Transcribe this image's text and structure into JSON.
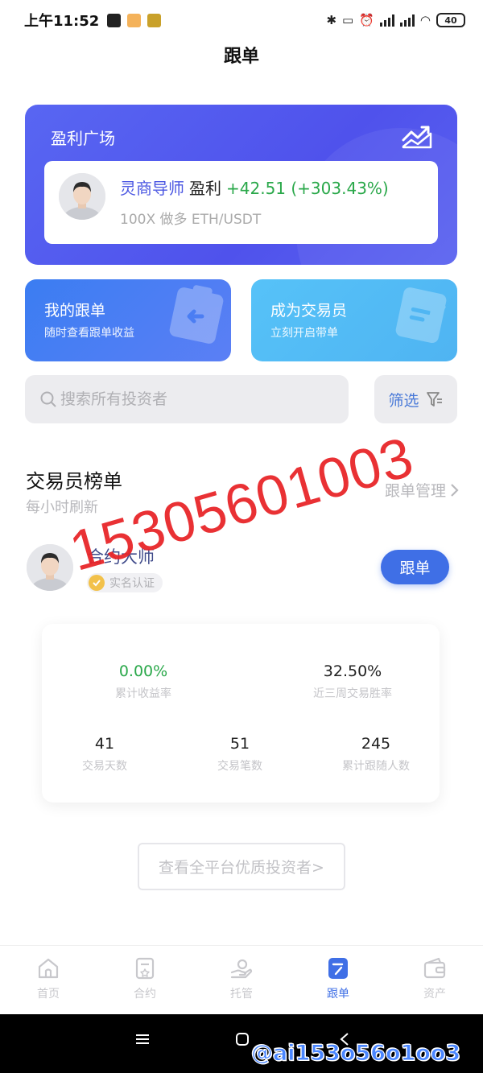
{
  "status_bar": {
    "time": "上午11:52",
    "battery": "40"
  },
  "header": {
    "title": "跟单"
  },
  "profit_square": {
    "title": "盈利广场",
    "trader_name": "灵商导师",
    "profit_label": "盈利",
    "profit_value": "+42.51 (+303.43%)",
    "position_desc": "100X 做多 ETH/USDT"
  },
  "quick_actions": [
    {
      "title": "我的跟单",
      "subtitle": "随时查看跟单收益"
    },
    {
      "title": "成为交易员",
      "subtitle": "立刻开启带单"
    }
  ],
  "search": {
    "placeholder": "搜索所有投资者",
    "filter_label": "筛选"
  },
  "leaderboard": {
    "title": "交易员榜单",
    "subtitle": "每小时刷新",
    "manage_link": "跟单管理"
  },
  "trader": {
    "name": "合约大师",
    "verified_label": "实名认证",
    "follow_label": "跟单",
    "stats": {
      "cumulative_return": {
        "value": "0.00%",
        "label": "累计收益率"
      },
      "win_rate_3w": {
        "value": "32.50%",
        "label": "近三周交易胜率"
      },
      "trading_days": {
        "value": "41",
        "label": "交易天数"
      },
      "trade_count": {
        "value": "51",
        "label": "交易笔数"
      },
      "followers": {
        "value": "245",
        "label": "累计跟随人数"
      }
    }
  },
  "view_all_label": "查看全平台优质投资者>",
  "watermark_text": "15305601003",
  "tiktok_handle": "@ai153o56o1oo3",
  "tabs": [
    {
      "label": "首页",
      "icon": "home-icon"
    },
    {
      "label": "合约",
      "icon": "contract-icon"
    },
    {
      "label": "托管",
      "icon": "custody-icon"
    },
    {
      "label": "跟单",
      "icon": "copy-trade-icon",
      "active": true
    },
    {
      "label": "资产",
      "icon": "wallet-icon"
    }
  ],
  "colors": {
    "primary": "#3f6fe6",
    "profit_card": "#5560ef",
    "positive": "#2aa84a",
    "watermark": "#e8262a"
  }
}
